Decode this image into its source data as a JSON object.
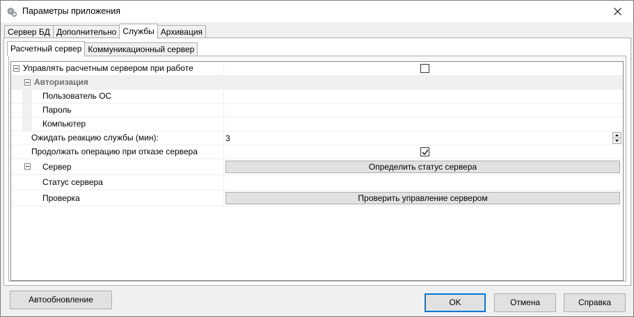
{
  "window": {
    "title": "Параметры приложения"
  },
  "outer_tabs": [
    {
      "label": "Сервер БД"
    },
    {
      "label": "Дополнительно"
    },
    {
      "label": "Службы"
    },
    {
      "label": "Архивация"
    }
  ],
  "inner_tabs": [
    {
      "label": "Расчетный сервер"
    },
    {
      "label": "Коммуникационный сервер"
    }
  ],
  "grid": {
    "manage_server": {
      "label": "Управлять расчетным сервером при работе",
      "checked": false
    },
    "auth_category": {
      "label": "Авторизация"
    },
    "os_user": {
      "label": "Пользователь ОС",
      "value": ""
    },
    "password": {
      "label": "Пароль",
      "value": ""
    },
    "computer": {
      "label": "Компьютер",
      "value": ""
    },
    "wait_response": {
      "label": "Ожидать реакцию службы (мин):",
      "value": "3"
    },
    "continue_on_fail": {
      "label": "Продолжать операцию при отказе сервера",
      "checked": true
    },
    "server_group": {
      "label": "Сервер",
      "button": "Определить статус сервера"
    },
    "server_status": {
      "label": "Статус сервера",
      "value": ""
    },
    "check": {
      "label": "Проверка",
      "button": "Проверить управление сервером"
    }
  },
  "buttons": {
    "auto_update": "Автообновление",
    "ok": "OK",
    "cancel": "Отмена",
    "help": "Справка"
  },
  "colors": {
    "focus_border": "#0078d7",
    "category_bg": "#f0f0f0",
    "button_bg": "#e1e1e1"
  }
}
